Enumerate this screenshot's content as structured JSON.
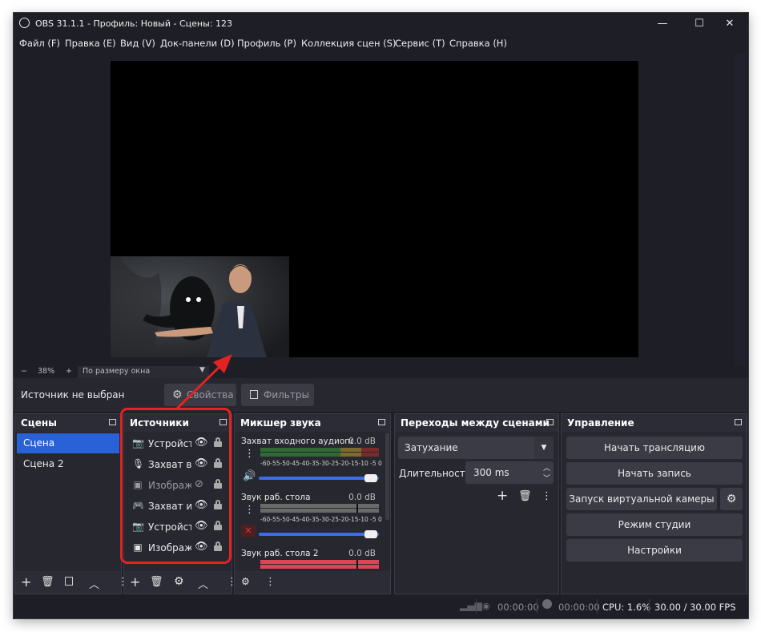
{
  "window": {
    "title": "OBS 31.1.1 - Профиль: Новый - Сцены: 123",
    "minimize": "—",
    "maximize": "☐",
    "close": "✕"
  },
  "menu": [
    "Файл (F)",
    "Правка (E)",
    "Вид (V)",
    "Док-панели (D)",
    "Профиль (P)",
    "Коллекция сцен (S)",
    "Сервис (T)",
    "Справка (H)"
  ],
  "zoom": {
    "minus": "−",
    "value": "38%",
    "plus": "+",
    "fit": "По размеру окна"
  },
  "properties_bar": {
    "no_source": "Источник не выбран",
    "properties_label": "Свойства",
    "filters_label": "Фильтры"
  },
  "scenes": {
    "title": "Сцены",
    "items": [
      "Сцена",
      "Сцена 2"
    ],
    "selected": 0
  },
  "sources": {
    "title": "Источники",
    "items": [
      {
        "label": "Устройства",
        "icon": "camera-icon",
        "visible": true
      },
      {
        "label": "Захват входного",
        "icon": "microphone-icon",
        "visible": true
      },
      {
        "label": "Изображение",
        "icon": "image-icon",
        "visible": false
      },
      {
        "label": "Захват игры",
        "icon": "gamepad-icon",
        "visible": true
      },
      {
        "label": "Устройства",
        "icon": "camera-icon",
        "visible": true
      },
      {
        "label": "Изображение",
        "icon": "image-icon",
        "visible": true
      }
    ]
  },
  "mixer": {
    "title": "Микшер звука",
    "scale": "-60-55-50-45-40-35-30-25-20-15-10 -5  0",
    "channels": [
      {
        "name": "Захват входного аудиопотока",
        "db": "0.0 dB",
        "muted": false
      },
      {
        "name": "Звук раб. стола",
        "db": "0.0 dB",
        "muted": true
      },
      {
        "name": "Звук раб. стола 2",
        "db": "0.0 dB",
        "muted": false
      }
    ]
  },
  "transitions": {
    "title": "Переходы между сценами",
    "selected": "Затухание",
    "duration_label": "Длительность",
    "duration_value": "300 ms"
  },
  "controls": {
    "title": "Управление",
    "buttons": [
      "Начать трансляцию",
      "Начать запись",
      "Запуск виртуальной камеры",
      "Режим студии",
      "Настройки"
    ]
  },
  "status": {
    "stream_time": "00:00:00",
    "record_time": "00:00:00",
    "cpu": "CPU: 1.6%",
    "fps": "30.00 / 30.00 FPS"
  },
  "colors": {
    "accent": "#2962d6",
    "annotation": "#e32222",
    "background": "#1e1f26"
  }
}
